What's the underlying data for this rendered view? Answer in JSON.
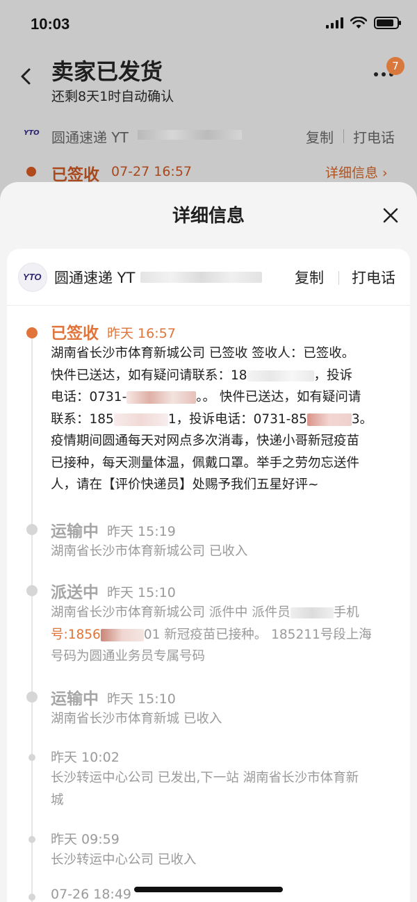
{
  "status_bar": {
    "time": "10:03"
  },
  "header": {
    "title": "卖家已发货",
    "subtitle": "还剩8天1时自动确认",
    "badge_count": "7"
  },
  "background_courier": {
    "logo": "YTO",
    "name": "圆通速递 YT",
    "copy_label": "复制",
    "call_label": "打电话",
    "status": "已签收",
    "time": "07-27 16:57",
    "detail_link": "详细信息 ›"
  },
  "sheet": {
    "title": "详细信息",
    "courier": {
      "logo": "YTO",
      "name": "圆通速递 YT",
      "copy_label": "复制",
      "call_label": "打电话"
    },
    "events": [
      {
        "status": "已签收",
        "time": "昨天 16:57",
        "desc_lines": [
          "湖南省长沙市体育新城公司 已签收 签收人：已签收。",
          "快件已送达，如有疑问请联系：18",
          "，投诉",
          "电话：0731-",
          "。。 快件已送达，如有疑问请",
          "联系：185",
          "1，投诉电话：0731-85",
          "3。",
          "疫情期间圆通每天对网点多次消毒，快递小哥新冠疫苗",
          "已接种，每天测量体温，佩戴口罩。举手之劳勿忘送件",
          "人，请在【评价快递员】处赐予我们五星好评~"
        ]
      },
      {
        "status": "运输中",
        "time": "昨天 15:19",
        "desc_lines": [
          "湖南省长沙市体育新城公司 已收入"
        ]
      },
      {
        "status": "派送中",
        "time": "昨天 15:10",
        "desc_lines": [
          "湖南省长沙市体育新城公司 派件中 派件员",
          "手机",
          "号:1856",
          "01 新冠疫苗已接种。 185211号段上海",
          "号码为圆通业务员专属号码"
        ]
      },
      {
        "status": "运输中",
        "time": "昨天 15:10",
        "desc_lines": [
          "湖南省长沙市体育新城 已收入"
        ]
      },
      {
        "status": "",
        "time": "昨天 10:02",
        "desc_lines": [
          "长沙转运中心公司 已发出,下一站 湖南省长沙市体育新",
          "城"
        ]
      },
      {
        "status": "",
        "time": "昨天 09:59",
        "desc_lines": [
          "长沙转运中心公司 已收入"
        ]
      },
      {
        "status": "",
        "time": "07-26 18:49",
        "desc_lines": []
      }
    ]
  },
  "colors": {
    "accent": "#e0743a",
    "muted": "#a6a6a6"
  }
}
